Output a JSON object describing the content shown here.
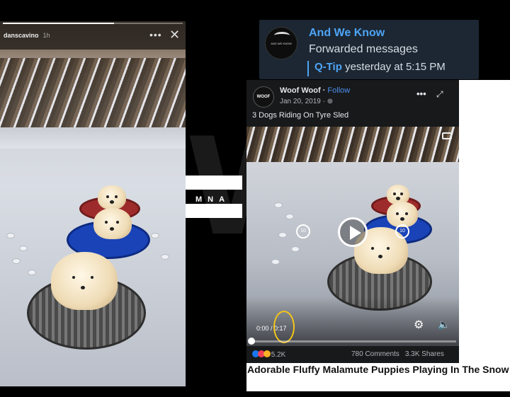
{
  "story": {
    "username": "danscavino",
    "age": "1h",
    "more_icon": "ellipsis-icon",
    "close_icon": "close-icon"
  },
  "watermark": {
    "big_letter": "W",
    "letters": "MNA"
  },
  "telegram": {
    "channel_name": "And We Know",
    "channel_avatar_text": "AND WE KNOW",
    "subtitle": "Forwarded messages",
    "reply_from": "Q-Tip",
    "reply_time": "yesterday at 5:15 PM"
  },
  "facebook": {
    "page_name": "Woof Woof",
    "follow_label": "Follow",
    "avatar_text": "WOOF",
    "date": "Jan 20, 2019",
    "caption": "3 Dogs Riding On Tyre Sled",
    "current_time": "0:00",
    "duration": "0:17",
    "skip_back": "10",
    "skip_forward": "10",
    "reaction_count": "5.2K",
    "comments": "780 Comments",
    "shares": "3.3K Shares",
    "headline": "Adorable Fluffy Malamute Puppies Playing In The Snow",
    "colors": {
      "accent": "#4b91f1",
      "highlight_ring": "#f5c518"
    }
  }
}
